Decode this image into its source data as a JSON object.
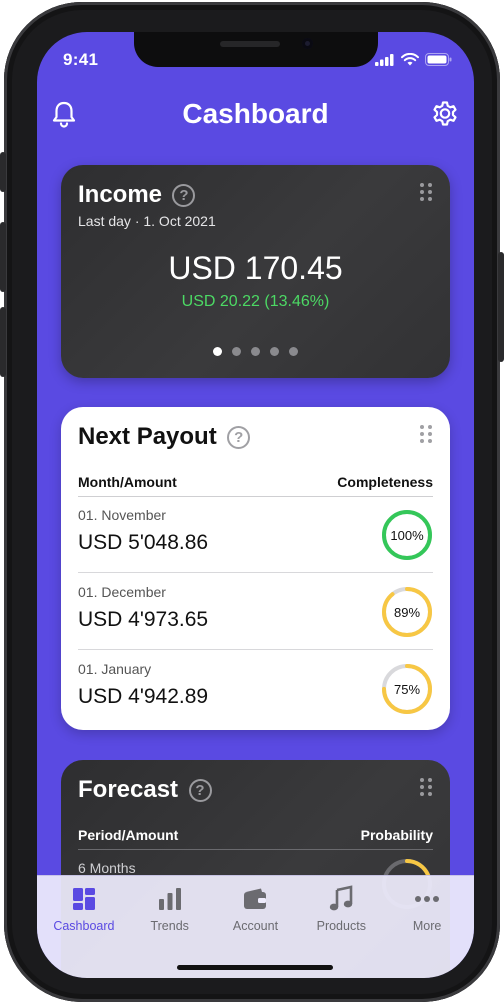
{
  "status": {
    "time": "9:41"
  },
  "header": {
    "title": "Cashboard"
  },
  "income": {
    "title": "Income",
    "subtitle": "Last day · 1. Oct 2021",
    "amount": "USD 170.45",
    "change": "USD 20.22 (13.46%)",
    "change_color": "#4cd964",
    "pages": 5,
    "active_page": 0
  },
  "payout": {
    "title": "Next Payout",
    "col_left": "Month/Amount",
    "col_right": "Completeness",
    "rows": [
      {
        "date": "01. November",
        "amount": "USD 5'048.86",
        "percent_label": "100%",
        "percent": 100,
        "color": "#34c759"
      },
      {
        "date": "01. December",
        "amount": "USD 4'973.65",
        "percent_label": "89%",
        "percent": 89,
        "color": "#f7c744"
      },
      {
        "date": "01. January",
        "amount": "USD 4'942.89",
        "percent_label": "75%",
        "percent": 75,
        "color": "#f7c744"
      }
    ]
  },
  "forecast": {
    "title": "Forecast",
    "col_left": "Period/Amount",
    "col_right": "Probability",
    "first_period": "6 Months"
  },
  "tabs": [
    {
      "label": "Cashboard",
      "icon": "dashboard-icon",
      "active": true
    },
    {
      "label": "Trends",
      "icon": "bar-chart-icon",
      "active": false
    },
    {
      "label": "Account",
      "icon": "wallet-icon",
      "active": false
    },
    {
      "label": "Products",
      "icon": "music-note-icon",
      "active": false
    },
    {
      "label": "More",
      "icon": "more-icon",
      "active": false
    }
  ],
  "colors": {
    "brand": "#5a4ae2",
    "card_dark": "#333335",
    "ring_track": "#d9d9dc"
  }
}
